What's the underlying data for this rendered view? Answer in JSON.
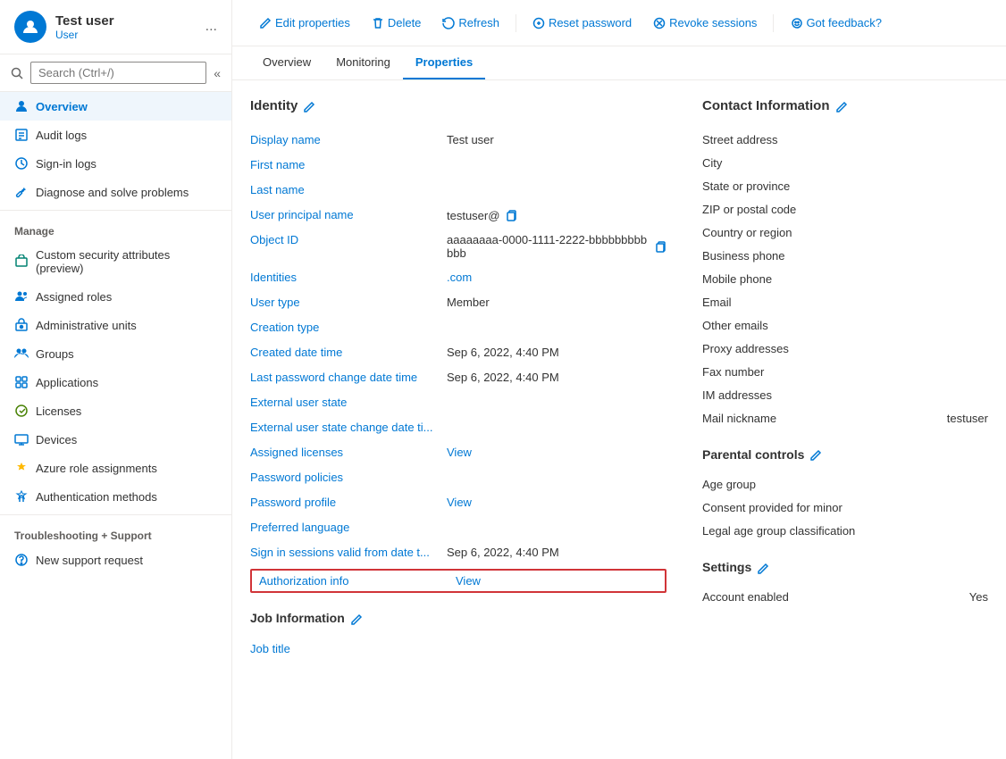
{
  "sidebar": {
    "user": {
      "name": "Test user",
      "type": "User",
      "more_label": "..."
    },
    "search": {
      "placeholder": "Search (Ctrl+/)"
    },
    "nav_items": [
      {
        "id": "overview",
        "label": "Overview",
        "active": true,
        "icon": "person"
      },
      {
        "id": "audit-logs",
        "label": "Audit logs",
        "active": false,
        "icon": "list"
      },
      {
        "id": "sign-in-logs",
        "label": "Sign-in logs",
        "active": false,
        "icon": "signin"
      },
      {
        "id": "diagnose",
        "label": "Diagnose and solve problems",
        "active": false,
        "icon": "wrench"
      }
    ],
    "manage_section": "Manage",
    "manage_items": [
      {
        "id": "custom-security",
        "label": "Custom security attributes (preview)",
        "icon": "shield"
      },
      {
        "id": "assigned-roles",
        "label": "Assigned roles",
        "icon": "person-roles"
      },
      {
        "id": "admin-units",
        "label": "Administrative units",
        "icon": "building"
      },
      {
        "id": "groups",
        "label": "Groups",
        "icon": "group"
      },
      {
        "id": "applications",
        "label": "Applications",
        "icon": "app"
      },
      {
        "id": "licenses",
        "label": "Licenses",
        "icon": "license"
      },
      {
        "id": "devices",
        "label": "Devices",
        "icon": "device"
      },
      {
        "id": "azure-roles",
        "label": "Azure role assignments",
        "icon": "key"
      },
      {
        "id": "auth-methods",
        "label": "Authentication methods",
        "icon": "auth"
      }
    ],
    "troubleshoot_section": "Troubleshooting + Support",
    "troubleshoot_items": [
      {
        "id": "new-support",
        "label": "New support request",
        "icon": "support"
      }
    ]
  },
  "toolbar": {
    "edit_label": "Edit properties",
    "delete_label": "Delete",
    "refresh_label": "Refresh",
    "reset_password_label": "Reset password",
    "revoke_sessions_label": "Revoke sessions",
    "feedback_label": "Got feedback?"
  },
  "tabs": [
    {
      "id": "overview",
      "label": "Overview",
      "active": false
    },
    {
      "id": "monitoring",
      "label": "Monitoring",
      "active": false
    },
    {
      "id": "properties",
      "label": "Properties",
      "active": true
    }
  ],
  "identity_section": {
    "title": "Identity",
    "properties": [
      {
        "label": "Display name",
        "value": "Test user",
        "copyable": false,
        "link": false
      },
      {
        "label": "First name",
        "value": "",
        "copyable": false,
        "link": false
      },
      {
        "label": "Last name",
        "value": "",
        "copyable": false,
        "link": false
      },
      {
        "label": "User principal name",
        "value": "testuser@",
        "copyable": true,
        "link": false
      },
      {
        "label": "Object ID",
        "value": "aaaaaaaa-0000-1111-2222-bbbbbbbbbbbb",
        "copyable": true,
        "link": false
      },
      {
        "label": "Identities",
        "value": ".com",
        "copyable": false,
        "link": true
      },
      {
        "label": "User type",
        "value": "Member",
        "copyable": false,
        "link": false
      },
      {
        "label": "Creation type",
        "value": "",
        "copyable": false,
        "link": false
      },
      {
        "label": "Created date time",
        "value": "Sep 6, 2022, 4:40 PM",
        "copyable": false,
        "link": false
      },
      {
        "label": "Last password change date time",
        "value": "Sep 6, 2022, 4:40 PM",
        "copyable": false,
        "link": false
      },
      {
        "label": "External user state",
        "value": "",
        "copyable": false,
        "link": false
      },
      {
        "label": "External user state change date ti...",
        "value": "",
        "copyable": false,
        "link": false
      },
      {
        "label": "Assigned licenses",
        "value": "View",
        "copyable": false,
        "link": true
      },
      {
        "label": "Password policies",
        "value": "",
        "copyable": false,
        "link": false
      },
      {
        "label": "Password profile",
        "value": "View",
        "copyable": false,
        "link": true
      },
      {
        "label": "Preferred language",
        "value": "",
        "copyable": false,
        "link": false
      },
      {
        "label": "Sign in sessions valid from date t...",
        "value": "Sep 6, 2022, 4:40 PM",
        "copyable": false,
        "link": false
      }
    ],
    "authorization_info": {
      "label": "Authorization info",
      "value": "View",
      "highlighted": true
    }
  },
  "job_section": {
    "title": "Job Information",
    "properties": [
      {
        "label": "Job title",
        "value": ""
      }
    ]
  },
  "contact_section": {
    "title": "Contact Information",
    "properties": [
      {
        "label": "Street address",
        "value": ""
      },
      {
        "label": "City",
        "value": ""
      },
      {
        "label": "State or province",
        "value": ""
      },
      {
        "label": "ZIP or postal code",
        "value": ""
      },
      {
        "label": "Country or region",
        "value": ""
      },
      {
        "label": "Business phone",
        "value": ""
      },
      {
        "label": "Mobile phone",
        "value": ""
      },
      {
        "label": "Email",
        "value": ""
      },
      {
        "label": "Other emails",
        "value": ""
      },
      {
        "label": "Proxy addresses",
        "value": ""
      },
      {
        "label": "Fax number",
        "value": ""
      },
      {
        "label": "IM addresses",
        "value": ""
      },
      {
        "label": "Mail nickname",
        "value": "testuser"
      }
    ]
  },
  "parental_section": {
    "title": "Parental controls",
    "properties": [
      {
        "label": "Age group",
        "value": ""
      },
      {
        "label": "Consent provided for minor",
        "value": ""
      },
      {
        "label": "Legal age group classification",
        "value": ""
      }
    ]
  },
  "settings_section": {
    "title": "Settings",
    "properties": [
      {
        "label": "Account enabled",
        "value": "Yes"
      }
    ]
  }
}
